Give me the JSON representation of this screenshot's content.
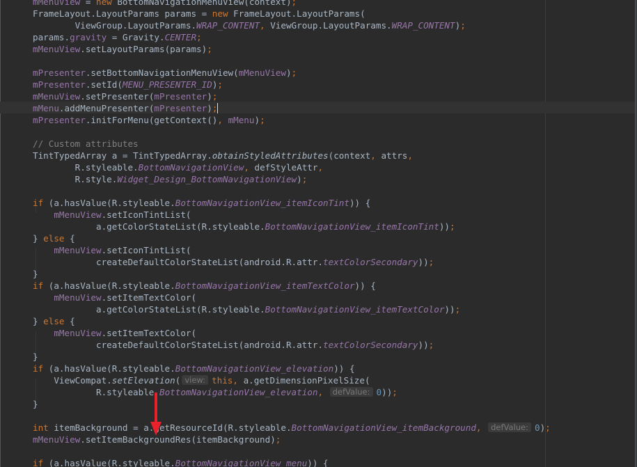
{
  "editor": {
    "lines": [
      [
        {
          "t": "mMenuView",
          "c": "fld"
        },
        {
          "t": " = "
        },
        {
          "t": "new",
          "c": "kw"
        },
        {
          "t": " BottomNavigationMenuView(context)"
        },
        {
          "t": ";",
          "c": "kw"
        }
      ],
      [
        {
          "t": "FrameLayout.LayoutParams params = "
        },
        {
          "t": "new",
          "c": "kw"
        },
        {
          "t": " FrameLayout.LayoutParams("
        }
      ],
      [
        {
          "t": "        ViewGroup.LayoutParams."
        },
        {
          "t": "WRAP_CONTENT",
          "c": "cst"
        },
        {
          "t": ", ",
          "c": "kw"
        },
        {
          "t": "ViewGroup.LayoutParams."
        },
        {
          "t": "WRAP_CONTENT",
          "c": "cst"
        },
        {
          "t": ")"
        },
        {
          "t": ";",
          "c": "kw"
        }
      ],
      [
        {
          "t": "params."
        },
        {
          "t": "gravity",
          "c": "fld"
        },
        {
          "t": " = Gravity."
        },
        {
          "t": "CENTER",
          "c": "cst"
        },
        {
          "t": ";",
          "c": "kw"
        }
      ],
      [
        {
          "t": "mMenuView",
          "c": "fld"
        },
        {
          "t": ".setLayoutParams(params)"
        },
        {
          "t": ";",
          "c": "kw"
        }
      ],
      [],
      [
        {
          "t": "mPresenter",
          "c": "fld"
        },
        {
          "t": ".setBottomNavigationMenuView("
        },
        {
          "t": "mMenuView",
          "c": "fld"
        },
        {
          "t": ")"
        },
        {
          "t": ";",
          "c": "kw"
        }
      ],
      [
        {
          "t": "mPresenter",
          "c": "fld"
        },
        {
          "t": ".setId("
        },
        {
          "t": "MENU_PRESENTER_ID",
          "c": "cst"
        },
        {
          "t": ")"
        },
        {
          "t": ";",
          "c": "kw"
        }
      ],
      [
        {
          "t": "mMenuView",
          "c": "fld"
        },
        {
          "t": ".setPresenter("
        },
        {
          "t": "mPresenter",
          "c": "fld"
        },
        {
          "t": ")"
        },
        {
          "t": ";",
          "c": "kw"
        }
      ],
      [
        {
          "t": "mMenu",
          "c": "fld"
        },
        {
          "t": ".addMenuPresenter("
        },
        {
          "t": "mPresenter",
          "c": "fld"
        },
        {
          "t": ")"
        },
        {
          "t": ";",
          "c": "kw"
        },
        {
          "caret": true
        }
      ],
      [
        {
          "t": "mPresenter",
          "c": "fld"
        },
        {
          "t": ".initForMenu(getContext()"
        },
        {
          "t": ", ",
          "c": "kw"
        },
        {
          "t": "mMenu",
          "c": "fld"
        },
        {
          "t": ")"
        },
        {
          "t": ";",
          "c": "kw"
        }
      ],
      [],
      [
        {
          "t": "// Custom attributes",
          "c": "cmt"
        }
      ],
      [
        {
          "t": "TintTypedArray a = TintTypedArray."
        },
        {
          "t": "obtainStyledAttributes",
          "c": "sm"
        },
        {
          "t": "(context"
        },
        {
          "t": ", ",
          "c": "kw"
        },
        {
          "t": "attrs"
        },
        {
          "t": ",",
          "c": "kw"
        }
      ],
      [
        {
          "t": "        R.styleable."
        },
        {
          "t": "BottomNavigationView",
          "c": "cst"
        },
        {
          "t": ", ",
          "c": "kw"
        },
        {
          "t": "defStyleAttr"
        },
        {
          "t": ",",
          "c": "kw"
        }
      ],
      [
        {
          "t": "        R.style."
        },
        {
          "t": "Widget_Design_BottomNavigationView",
          "c": "cst"
        },
        {
          "t": ")"
        },
        {
          "t": ";",
          "c": "kw"
        }
      ],
      [],
      [
        {
          "t": "if",
          "c": "kw"
        },
        {
          "t": " (a.hasValue(R.styleable."
        },
        {
          "t": "BottomNavigationView_itemIconTint",
          "c": "cst"
        },
        {
          "t": ")) {"
        }
      ],
      [
        {
          "t": "    "
        },
        {
          "t": "mMenuView",
          "c": "fld"
        },
        {
          "t": ".setIconTintList("
        }
      ],
      [
        {
          "t": "            a.getColorStateList(R.styleable."
        },
        {
          "t": "BottomNavigationView_itemIconTint",
          "c": "cst"
        },
        {
          "t": "))"
        },
        {
          "t": ";",
          "c": "kw"
        }
      ],
      [
        {
          "t": "} "
        },
        {
          "t": "else",
          "c": "kw"
        },
        {
          "t": " {"
        }
      ],
      [
        {
          "t": "    "
        },
        {
          "t": "mMenuView",
          "c": "fld"
        },
        {
          "t": ".setIconTintList("
        }
      ],
      [
        {
          "t": "            createDefaultColorStateList(android.R.attr."
        },
        {
          "t": "textColorSecondary",
          "c": "cst"
        },
        {
          "t": "))"
        },
        {
          "t": ";",
          "c": "kw"
        }
      ],
      [
        {
          "t": "}"
        }
      ],
      [
        {
          "t": "if",
          "c": "kw"
        },
        {
          "t": " (a.hasValue(R.styleable."
        },
        {
          "t": "BottomNavigationView_itemTextColor",
          "c": "cst"
        },
        {
          "t": ")) {"
        }
      ],
      [
        {
          "t": "    "
        },
        {
          "t": "mMenuView",
          "c": "fld"
        },
        {
          "t": ".setItemTextColor("
        }
      ],
      [
        {
          "t": "            a.getColorStateList(R.styleable."
        },
        {
          "t": "BottomNavigationView_itemTextColor",
          "c": "cst"
        },
        {
          "t": "))"
        },
        {
          "t": ";",
          "c": "kw"
        }
      ],
      [
        {
          "t": "} "
        },
        {
          "t": "else",
          "c": "kw"
        },
        {
          "t": " {"
        }
      ],
      [
        {
          "t": "    "
        },
        {
          "t": "mMenuView",
          "c": "fld"
        },
        {
          "t": ".setItemTextColor("
        }
      ],
      [
        {
          "t": "            createDefaultColorStateList(android.R.attr."
        },
        {
          "t": "textColorSecondary",
          "c": "cst"
        },
        {
          "t": "))"
        },
        {
          "t": ";",
          "c": "kw"
        }
      ],
      [
        {
          "t": "}"
        }
      ],
      [
        {
          "t": "if",
          "c": "kw"
        },
        {
          "t": " (a.hasValue(R.styleable."
        },
        {
          "t": "BottomNavigationView_elevation",
          "c": "cst"
        },
        {
          "t": ")) {"
        }
      ],
      [
        {
          "t": "    ViewCompat."
        },
        {
          "t": "setElevation",
          "c": "sm"
        },
        {
          "t": "("
        },
        {
          "hint": "view:"
        },
        {
          "t": "this",
          "c": "kw"
        },
        {
          "t": ", ",
          "c": "kw"
        },
        {
          "t": "a.getDimensionPixelSize("
        }
      ],
      [
        {
          "t": "            R.styleable."
        },
        {
          "t": "BottomNavigationView_elevation",
          "c": "cst"
        },
        {
          "t": ", ",
          "c": "kw"
        },
        {
          "hint": "defValue:"
        },
        {
          "t": "0",
          "c": "num"
        },
        {
          "t": "))"
        },
        {
          "t": ";",
          "c": "kw"
        }
      ],
      [
        {
          "t": "}"
        }
      ],
      [],
      [
        {
          "t": "int",
          "c": "kw"
        },
        {
          "t": " itemBackground = a.getResourceId(R.styleable."
        },
        {
          "t": "BottomNavigationView_itemBackground",
          "c": "cst"
        },
        {
          "t": ", ",
          "c": "kw"
        },
        {
          "hint": "defValue:"
        },
        {
          "t": "0",
          "c": "num"
        },
        {
          "t": ")"
        },
        {
          "t": ";",
          "c": "kw"
        }
      ],
      [
        {
          "t": "mMenuView",
          "c": "fld"
        },
        {
          "t": ".setItemBackgroundRes(itemBackground)"
        },
        {
          "t": ";",
          "c": "kw"
        }
      ],
      [],
      [
        {
          "t": "if",
          "c": "kw"
        },
        {
          "t": " (a.hasValue(R.styleable."
        },
        {
          "t": "BottomNavigationView_menu",
          "c": "cst"
        },
        {
          "t": ")) {"
        }
      ]
    ]
  },
  "colors": {
    "background": "#2b2b2b",
    "text": "#a9b7c6",
    "keyword": "#cc7832",
    "field": "#9876aa",
    "number": "#6897bb",
    "comment": "#808080",
    "annotation_arrow": "#e8212b"
  },
  "annotation": {
    "icon": "red-down-arrow-icon"
  }
}
